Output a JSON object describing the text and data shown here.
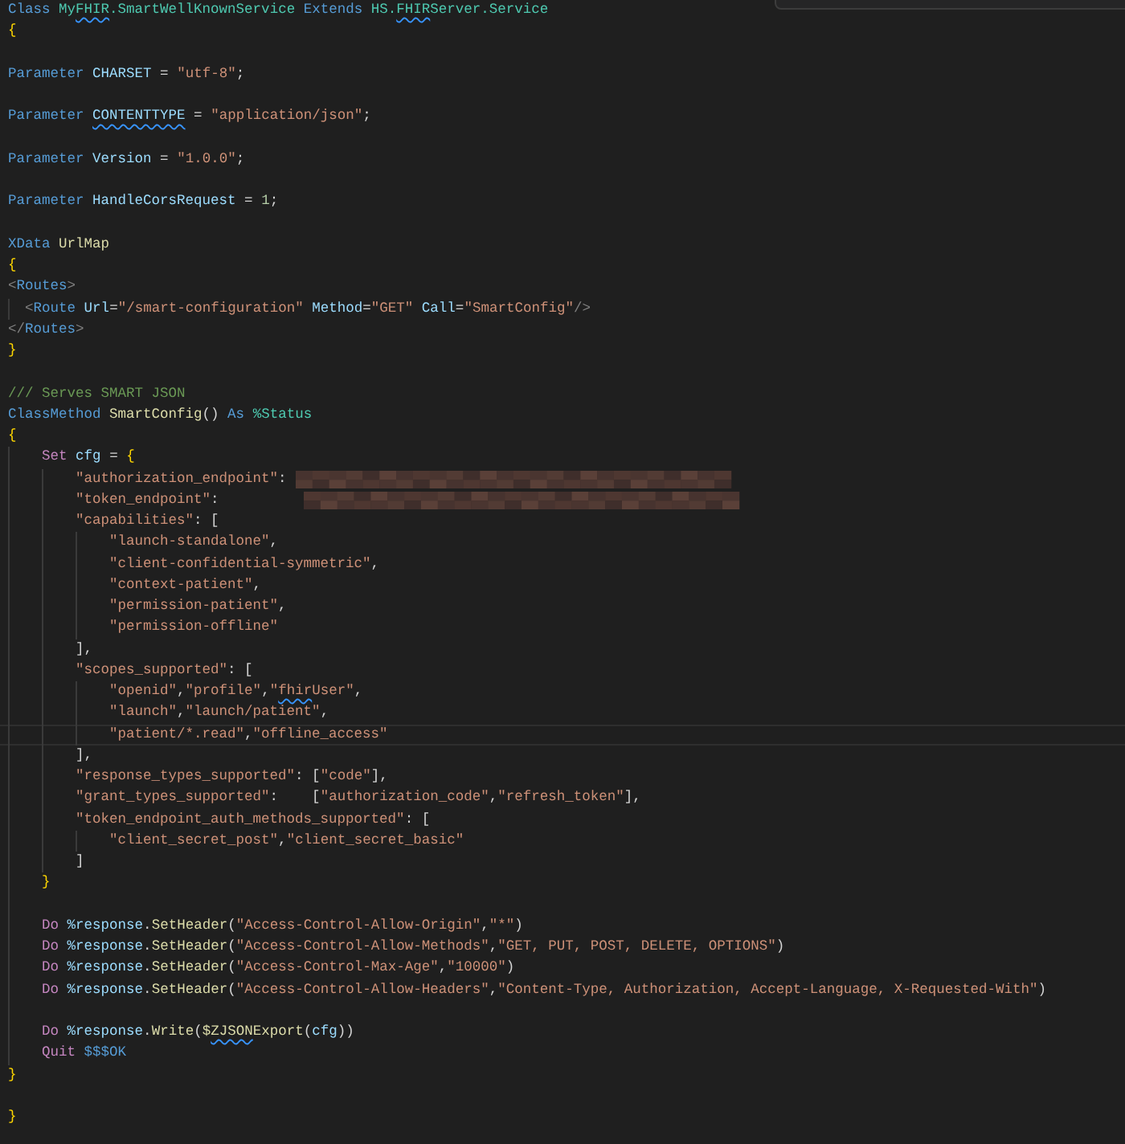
{
  "editor": {
    "lines": [
      {
        "kind": "code",
        "tokens": [
          {
            "kind": "kw",
            "text": "Class "
          },
          {
            "kind": "type",
            "text": "My"
          },
          {
            "kind": "type",
            "text": "FHIR",
            "flagged": true
          },
          {
            "kind": "type",
            "text": ".SmartWellKnownService "
          },
          {
            "kind": "kw",
            "text": "Extends "
          },
          {
            "kind": "type",
            "text": "HS."
          },
          {
            "kind": "type",
            "text": "FHIR",
            "flagged": true
          },
          {
            "kind": "type",
            "text": "Server.Service"
          }
        ]
      },
      {
        "kind": "code",
        "tokens": [
          {
            "kind": "brace",
            "text": "{"
          }
        ]
      },
      {
        "kind": "blank"
      },
      {
        "kind": "code",
        "tokens": [
          {
            "kind": "kw",
            "text": "Parameter "
          },
          {
            "kind": "var",
            "text": "CHARSET"
          },
          {
            "kind": "p",
            "text": " = "
          },
          {
            "kind": "str",
            "text": "\"utf-8\""
          },
          {
            "kind": "p",
            "text": ";"
          }
        ]
      },
      {
        "kind": "blank"
      },
      {
        "kind": "code",
        "tokens": [
          {
            "kind": "kw",
            "text": "Parameter "
          },
          {
            "kind": "var",
            "text": "CONTENTTYPE",
            "flagged": true
          },
          {
            "kind": "p",
            "text": " = "
          },
          {
            "kind": "str",
            "text": "\"application/json\""
          },
          {
            "kind": "p",
            "text": ";"
          }
        ]
      },
      {
        "kind": "blank"
      },
      {
        "kind": "code",
        "tokens": [
          {
            "kind": "kw",
            "text": "Parameter "
          },
          {
            "kind": "var",
            "text": "Version"
          },
          {
            "kind": "p",
            "text": " = "
          },
          {
            "kind": "str",
            "text": "\"1.0.0\""
          },
          {
            "kind": "p",
            "text": ";"
          }
        ]
      },
      {
        "kind": "blank"
      },
      {
        "kind": "code",
        "tokens": [
          {
            "kind": "kw",
            "text": "Parameter "
          },
          {
            "kind": "var",
            "text": "HandleCorsRequest"
          },
          {
            "kind": "p",
            "text": " = "
          },
          {
            "kind": "num",
            "text": "1"
          },
          {
            "kind": "p",
            "text": ";"
          }
        ]
      },
      {
        "kind": "blank"
      },
      {
        "kind": "code",
        "tokens": [
          {
            "kind": "kw",
            "text": "XData "
          },
          {
            "kind": "fn",
            "text": "UrlMap"
          }
        ]
      },
      {
        "kind": "code",
        "tokens": [
          {
            "kind": "brace",
            "text": "{"
          }
        ]
      },
      {
        "kind": "code",
        "tokens": [
          {
            "kind": "tag",
            "text": "<"
          },
          {
            "kind": "kw",
            "text": "Routes"
          },
          {
            "kind": "tag",
            "text": ">"
          }
        ]
      },
      {
        "kind": "code",
        "tokens": [
          {
            "kind": "tag",
            "text": "  <"
          },
          {
            "kind": "kw",
            "text": "Route "
          },
          {
            "kind": "var",
            "text": "Url"
          },
          {
            "kind": "p",
            "text": "="
          },
          {
            "kind": "str",
            "text": "\"/smart-configuration\" "
          },
          {
            "kind": "var",
            "text": "Method"
          },
          {
            "kind": "p",
            "text": "="
          },
          {
            "kind": "str",
            "text": "\"GET\" "
          },
          {
            "kind": "var",
            "text": "Call"
          },
          {
            "kind": "p",
            "text": "="
          },
          {
            "kind": "str",
            "text": "\"SmartConfig\""
          },
          {
            "kind": "tag",
            "text": "/>"
          }
        ]
      },
      {
        "kind": "code",
        "tokens": [
          {
            "kind": "tag",
            "text": "</"
          },
          {
            "kind": "kw",
            "text": "Routes"
          },
          {
            "kind": "tag",
            "text": ">"
          }
        ]
      },
      {
        "kind": "code",
        "tokens": [
          {
            "kind": "brace",
            "text": "}"
          }
        ]
      },
      {
        "kind": "blank"
      },
      {
        "kind": "code",
        "tokens": [
          {
            "kind": "cmt",
            "text": "/// Serves SMART JSON"
          }
        ]
      },
      {
        "kind": "code",
        "tokens": [
          {
            "kind": "kw",
            "text": "ClassMethod "
          },
          {
            "kind": "fn",
            "text": "SmartConfig"
          },
          {
            "kind": "p",
            "text": "() "
          },
          {
            "kind": "kw",
            "text": "As "
          },
          {
            "kind": "type",
            "text": "%Status"
          }
        ]
      },
      {
        "kind": "code",
        "tokens": [
          {
            "kind": "brace",
            "text": "{"
          }
        ]
      },
      {
        "kind": "code",
        "tokens": [
          {
            "kind": "ctl",
            "text": "    Set "
          },
          {
            "kind": "var",
            "text": "cfg"
          },
          {
            "kind": "p",
            "text": " = "
          },
          {
            "kind": "brace",
            "text": "{"
          }
        ]
      },
      {
        "kind": "code",
        "tokens": [
          {
            "kind": "str",
            "text": "        \"authorization_endpoint\""
          },
          {
            "kind": "p",
            "text": ": "
          },
          {
            "kind": "redacted"
          }
        ]
      },
      {
        "kind": "code",
        "tokens": [
          {
            "kind": "str",
            "text": "        \"token_endpoint\""
          },
          {
            "kind": "p",
            "text": ":          "
          },
          {
            "kind": "redacted"
          }
        ]
      },
      {
        "kind": "code",
        "tokens": [
          {
            "kind": "str",
            "text": "        \"capabilities\""
          },
          {
            "kind": "p",
            "text": ": ["
          }
        ]
      },
      {
        "kind": "code",
        "tokens": [
          {
            "kind": "str",
            "text": "            \"launch-standalone\""
          },
          {
            "kind": "p",
            "text": ","
          }
        ]
      },
      {
        "kind": "code",
        "tokens": [
          {
            "kind": "str",
            "text": "            \"client-confidential-symmetric\""
          },
          {
            "kind": "p",
            "text": ","
          }
        ]
      },
      {
        "kind": "code",
        "tokens": [
          {
            "kind": "str",
            "text": "            \"context-patient\""
          },
          {
            "kind": "p",
            "text": ","
          }
        ]
      },
      {
        "kind": "code",
        "tokens": [
          {
            "kind": "str",
            "text": "            \"permission-patient\""
          },
          {
            "kind": "p",
            "text": ","
          }
        ]
      },
      {
        "kind": "code",
        "tokens": [
          {
            "kind": "str",
            "text": "            \"permission-offline\""
          }
        ]
      },
      {
        "kind": "code",
        "tokens": [
          {
            "kind": "p",
            "text": "        ],"
          }
        ]
      },
      {
        "kind": "code",
        "tokens": [
          {
            "kind": "str",
            "text": "        \"scopes_supported\""
          },
          {
            "kind": "p",
            "text": ": ["
          }
        ]
      },
      {
        "kind": "code",
        "tokens": [
          {
            "kind": "str",
            "text": "            \"openid\""
          },
          {
            "kind": "p",
            "text": ","
          },
          {
            "kind": "str",
            "text": "\"profile\""
          },
          {
            "kind": "p",
            "text": ","
          },
          {
            "kind": "str",
            "text": "\""
          },
          {
            "kind": "str",
            "text": "fhir",
            "flagged": true
          },
          {
            "kind": "str",
            "text": "User\""
          },
          {
            "kind": "p",
            "text": ","
          }
        ]
      },
      {
        "kind": "code",
        "tokens": [
          {
            "kind": "str",
            "text": "            \"launch\""
          },
          {
            "kind": "p",
            "text": ","
          },
          {
            "kind": "str",
            "text": "\"launch/patient\""
          },
          {
            "kind": "p",
            "text": ","
          }
        ]
      },
      {
        "kind": "code",
        "current": true,
        "tokens": [
          {
            "kind": "str",
            "text": "            \"patient/*.read\""
          },
          {
            "kind": "p",
            "text": ","
          },
          {
            "kind": "str",
            "text": "\"offline_access\""
          }
        ]
      },
      {
        "kind": "code",
        "tokens": [
          {
            "kind": "p",
            "text": "        ],"
          }
        ]
      },
      {
        "kind": "code",
        "tokens": [
          {
            "kind": "str",
            "text": "        \"response_types_supported\""
          },
          {
            "kind": "p",
            "text": ": ["
          },
          {
            "kind": "str",
            "text": "\"code\""
          },
          {
            "kind": "p",
            "text": "],"
          }
        ]
      },
      {
        "kind": "code",
        "tokens": [
          {
            "kind": "str",
            "text": "        \"grant_types_supported\""
          },
          {
            "kind": "p",
            "text": ":    ["
          },
          {
            "kind": "str",
            "text": "\"authorization_code\""
          },
          {
            "kind": "p",
            "text": ","
          },
          {
            "kind": "str",
            "text": "\"refresh_token\""
          },
          {
            "kind": "p",
            "text": "],"
          }
        ]
      },
      {
        "kind": "code",
        "tokens": [
          {
            "kind": "str",
            "text": "        \"token_endpoint_auth_methods_supported\""
          },
          {
            "kind": "p",
            "text": ": ["
          }
        ]
      },
      {
        "kind": "code",
        "tokens": [
          {
            "kind": "str",
            "text": "            \"client_secret_post\""
          },
          {
            "kind": "p",
            "text": ","
          },
          {
            "kind": "str",
            "text": "\"client_secret_basic\""
          }
        ]
      },
      {
        "kind": "code",
        "tokens": [
          {
            "kind": "p",
            "text": "        ]"
          }
        ]
      },
      {
        "kind": "code",
        "tokens": [
          {
            "kind": "brace",
            "text": "    }"
          }
        ]
      },
      {
        "kind": "blank"
      },
      {
        "kind": "code",
        "tokens": [
          {
            "kind": "ctl",
            "text": "    Do "
          },
          {
            "kind": "var",
            "text": "%response"
          },
          {
            "kind": "p",
            "text": "."
          },
          {
            "kind": "fn",
            "text": "SetHeader"
          },
          {
            "kind": "p",
            "text": "("
          },
          {
            "kind": "str",
            "text": "\"Access-Control-Allow-Origin\""
          },
          {
            "kind": "p",
            "text": ","
          },
          {
            "kind": "str",
            "text": "\"*\""
          },
          {
            "kind": "p",
            "text": ")"
          }
        ]
      },
      {
        "kind": "code",
        "tokens": [
          {
            "kind": "ctl",
            "text": "    Do "
          },
          {
            "kind": "var",
            "text": "%response"
          },
          {
            "kind": "p",
            "text": "."
          },
          {
            "kind": "fn",
            "text": "SetHeader"
          },
          {
            "kind": "p",
            "text": "("
          },
          {
            "kind": "str",
            "text": "\"Access-Control-Allow-Methods\""
          },
          {
            "kind": "p",
            "text": ","
          },
          {
            "kind": "str",
            "text": "\"GET, PUT, POST, DELETE, OPTIONS\""
          },
          {
            "kind": "p",
            "text": ")"
          }
        ]
      },
      {
        "kind": "code",
        "tokens": [
          {
            "kind": "ctl",
            "text": "    Do "
          },
          {
            "kind": "var",
            "text": "%response"
          },
          {
            "kind": "p",
            "text": "."
          },
          {
            "kind": "fn",
            "text": "SetHeader"
          },
          {
            "kind": "p",
            "text": "("
          },
          {
            "kind": "str",
            "text": "\"Access-Control-Max-Age\""
          },
          {
            "kind": "p",
            "text": ","
          },
          {
            "kind": "str",
            "text": "\"10000\""
          },
          {
            "kind": "p",
            "text": ")"
          }
        ]
      },
      {
        "kind": "code",
        "tokens": [
          {
            "kind": "ctl",
            "text": "    Do "
          },
          {
            "kind": "var",
            "text": "%response"
          },
          {
            "kind": "p",
            "text": "."
          },
          {
            "kind": "fn",
            "text": "SetHeader"
          },
          {
            "kind": "p",
            "text": "("
          },
          {
            "kind": "str",
            "text": "\"Access-Control-Allow-Headers\""
          },
          {
            "kind": "p",
            "text": ","
          },
          {
            "kind": "str",
            "text": "\"Content-Type, Authorization, Accept-Language, X-Requested-With\""
          },
          {
            "kind": "p",
            "text": ")"
          }
        ]
      },
      {
        "kind": "blank"
      },
      {
        "kind": "code",
        "tokens": [
          {
            "kind": "ctl",
            "text": "    Do "
          },
          {
            "kind": "var",
            "text": "%response"
          },
          {
            "kind": "p",
            "text": "."
          },
          {
            "kind": "fn",
            "text": "Write"
          },
          {
            "kind": "p",
            "text": "("
          },
          {
            "kind": "fn",
            "text": "$"
          },
          {
            "kind": "fn",
            "text": "ZJSON",
            "flagged": true
          },
          {
            "kind": "fn",
            "text": "Export"
          },
          {
            "kind": "p",
            "text": "("
          },
          {
            "kind": "var",
            "text": "cfg"
          },
          {
            "kind": "p",
            "text": "))"
          }
        ]
      },
      {
        "kind": "code",
        "tokens": [
          {
            "kind": "ctl",
            "text": "    Quit "
          },
          {
            "kind": "kw",
            "text": "$$$OK"
          }
        ]
      },
      {
        "kind": "code",
        "tokens": [
          {
            "kind": "brace",
            "text": "}"
          }
        ]
      },
      {
        "kind": "blank"
      },
      {
        "kind": "code",
        "tokens": [
          {
            "kind": "brace",
            "text": "}"
          }
        ]
      }
    ]
  }
}
